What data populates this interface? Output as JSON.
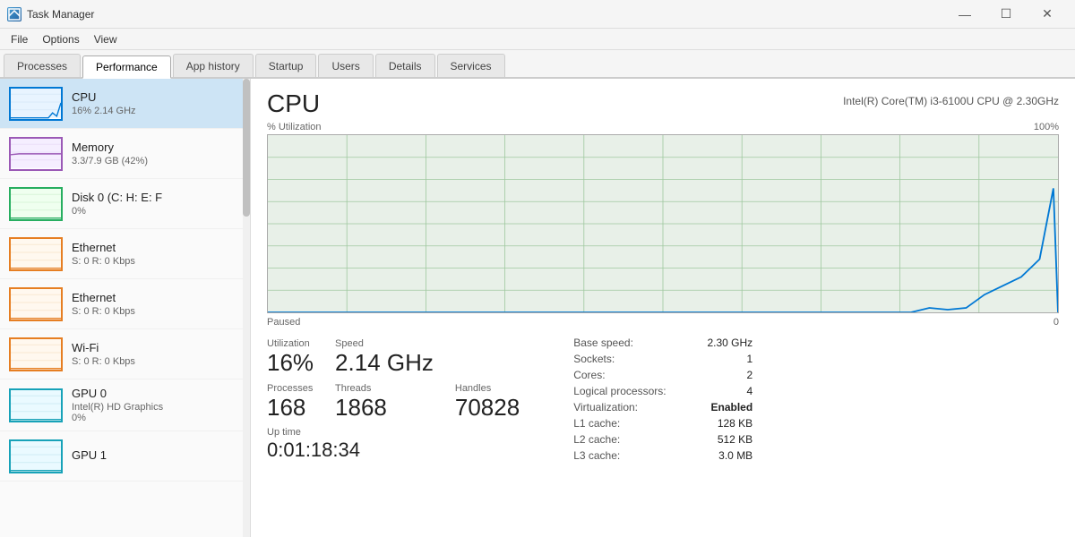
{
  "window": {
    "title": "Task Manager",
    "icon": "TM"
  },
  "titlebar_buttons": {
    "minimize": "—",
    "maximize": "☐",
    "close": "✕"
  },
  "menubar": {
    "items": [
      "File",
      "Options",
      "View"
    ]
  },
  "tabs": [
    {
      "id": "processes",
      "label": "Processes",
      "active": false
    },
    {
      "id": "performance",
      "label": "Performance",
      "active": true
    },
    {
      "id": "app-history",
      "label": "App history",
      "active": false
    },
    {
      "id": "startup",
      "label": "Startup",
      "active": false
    },
    {
      "id": "users",
      "label": "Users",
      "active": false
    },
    {
      "id": "details",
      "label": "Details",
      "active": false
    },
    {
      "id": "services",
      "label": "Services",
      "active": false
    }
  ],
  "sidebar": {
    "items": [
      {
        "id": "cpu",
        "name": "CPU",
        "sub": "16% 2.14 GHz",
        "border": "cpu-border",
        "active": true
      },
      {
        "id": "memory",
        "name": "Memory",
        "sub": "3.3/7.9 GB (42%)",
        "border": "mem-border",
        "active": false
      },
      {
        "id": "disk0",
        "name": "Disk 0 (C: H: E: F",
        "sub": "0%",
        "border": "disk-border",
        "active": false
      },
      {
        "id": "ethernet1",
        "name": "Ethernet",
        "sub": "S: 0 R: 0 Kbps",
        "border": "eth1-border",
        "active": false
      },
      {
        "id": "ethernet2",
        "name": "Ethernet",
        "sub": "S: 0 R: 0 Kbps",
        "border": "eth2-border",
        "active": false
      },
      {
        "id": "wifi",
        "name": "Wi-Fi",
        "sub": "S: 0 R: 0 Kbps",
        "border": "wifi-border",
        "active": false
      },
      {
        "id": "gpu0",
        "name": "GPU 0",
        "sub": "Intel(R) HD Graphics\n0%",
        "border": "gpu0-border",
        "active": false
      },
      {
        "id": "gpu1",
        "name": "GPU 1",
        "sub": "",
        "border": "gpu1-border",
        "active": false
      }
    ]
  },
  "detail": {
    "title": "CPU",
    "model": "Intel(R) Core(TM) i3-6100U CPU @ 2.30GHz",
    "chart": {
      "y_label": "% Utilization",
      "y_max": "100%",
      "y_min": "0",
      "status": "Paused"
    },
    "stats": {
      "utilization_label": "Utilization",
      "utilization_value": "16%",
      "speed_label": "Speed",
      "speed_value": "2.14 GHz",
      "processes_label": "Processes",
      "processes_value": "168",
      "threads_label": "Threads",
      "threads_value": "1868",
      "handles_label": "Handles",
      "handles_value": "70828",
      "uptime_label": "Up time",
      "uptime_value": "0:01:18:34"
    },
    "specs": {
      "base_speed_label": "Base speed:",
      "base_speed_value": "2.30 GHz",
      "sockets_label": "Sockets:",
      "sockets_value": "1",
      "cores_label": "Cores:",
      "cores_value": "2",
      "logical_processors_label": "Logical processors:",
      "logical_processors_value": "4",
      "virtualization_label": "Virtualization:",
      "virtualization_value": "Enabled",
      "l1_cache_label": "L1 cache:",
      "l1_cache_value": "128 KB",
      "l2_cache_label": "L2 cache:",
      "l2_cache_value": "512 KB",
      "l3_cache_label": "L3 cache:",
      "l3_cache_value": "3.0 MB"
    }
  }
}
